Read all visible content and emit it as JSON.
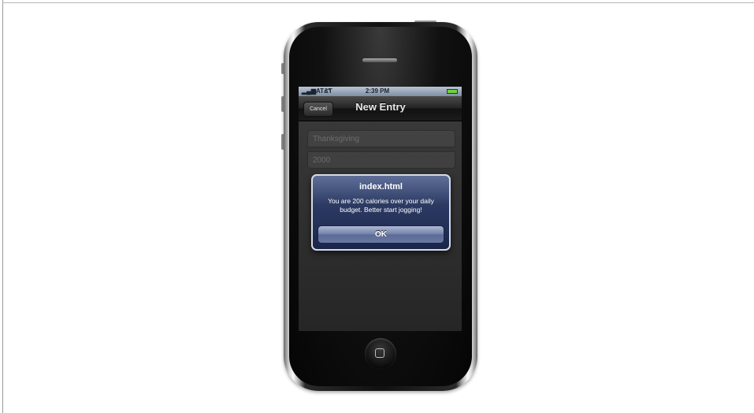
{
  "status_bar": {
    "carrier": "AT&T",
    "time": "2:39 PM",
    "wifi_icon": "wifi-icon",
    "signal_icon": "signal-icon",
    "battery_icon": "battery-icon"
  },
  "navbar": {
    "cancel_label": "Cancel",
    "title": "New Entry"
  },
  "form": {
    "food_value": "Thanksgiving",
    "calories_value": "2000"
  },
  "alert": {
    "title": "index.html",
    "message": "You are 200 calories over your daily budget. Better start jogging!",
    "ok_label": "OK"
  },
  "colors": {
    "alert_bg": "#2c3a63",
    "status_bar": "#9aa8b9",
    "battery": "#6fd143"
  }
}
